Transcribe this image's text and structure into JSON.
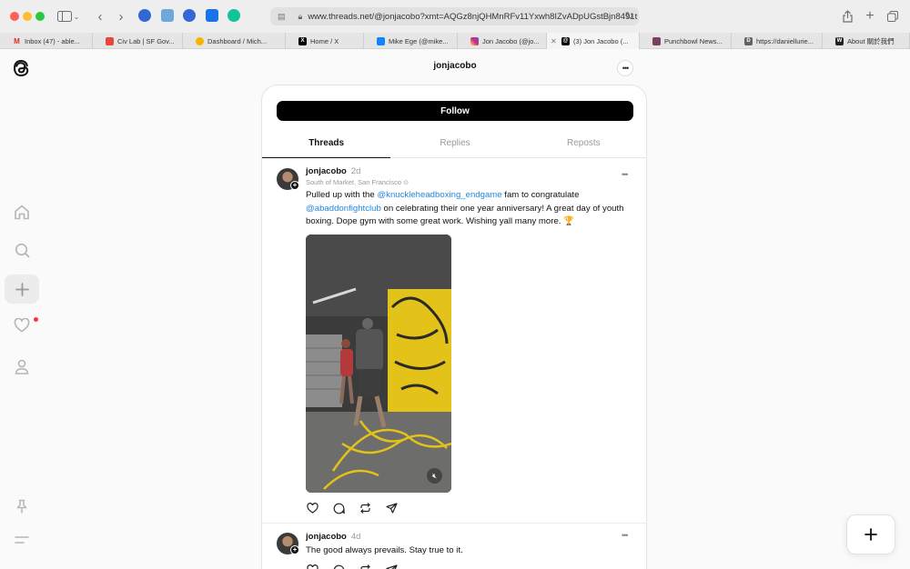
{
  "browser": {
    "url": "www.threads.net/@jonjacobo?xmt=AQGz8njQHMnRFv11Yxwh8IZvADpUGstBjn8491t",
    "tabs": [
      {
        "label": "Inbox (47) - able...",
        "favicon": "M",
        "color": "#d93025",
        "active": false
      },
      {
        "label": "Civ Lab | SF Gov...",
        "favicon": "",
        "color": "#e8453c",
        "active": false
      },
      {
        "label": "Dashboard / Mich...",
        "favicon": "",
        "color": "#f4b400",
        "active": false
      },
      {
        "label": "Home / X",
        "favicon": "X",
        "color": "#000000",
        "active": false
      },
      {
        "label": "Mike Ege (@mike...",
        "favicon": "",
        "color": "#1185fe",
        "active": false
      },
      {
        "label": "Jon Jacobo (@jo...",
        "favicon": "",
        "color": "#d62976",
        "active": false
      },
      {
        "label": "(3) Jon Jacobo (...",
        "favicon": "@",
        "color": "#000000",
        "active": true
      },
      {
        "label": "Punchbowl News...",
        "favicon": "",
        "color": "#7b3f61",
        "active": false
      },
      {
        "label": "https://daniellurie...",
        "favicon": "D",
        "color": "#5f6368",
        "active": false
      },
      {
        "label": "About 關於我們",
        "favicon": "W",
        "color": "#222222",
        "active": false
      }
    ]
  },
  "profile": {
    "username": "jonjacobo",
    "follow_label": "Follow",
    "tabs": [
      "Threads",
      "Replies",
      "Reposts"
    ]
  },
  "posts": [
    {
      "user": "jonjacobo",
      "time": "2d",
      "location": "South of Market, San Francisco",
      "text_before": "Pulled up with the ",
      "mention1": "@knuckleheadboxing_endgame",
      "text_middle": " fam to congratulate ",
      "mention2": "@abaddonfightclub",
      "text_after": " on celebrating their one year anniversary! A great day of youth boxing. Dope gym with some great work. Wishing yall many more. 🏆"
    },
    {
      "user": "jonjacobo",
      "time": "4d",
      "text": "The good always prevails. Stay true to it."
    }
  ]
}
